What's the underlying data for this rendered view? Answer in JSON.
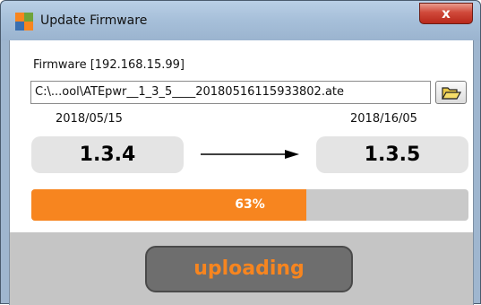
{
  "window": {
    "title": "Update Firmware",
    "close_label": "x"
  },
  "firmware": {
    "label": "Firmware [192.168.15.99]",
    "path_value": "C:\\...ool\\ATEpwr__1_3_5____20180516115933802.ate",
    "browse_icon": "open-folder-icon"
  },
  "current": {
    "date": "2018/05/15",
    "version": "1.3.4"
  },
  "target": {
    "date": "2018/16/05",
    "version": "1.3.5"
  },
  "progress": {
    "percent": 63,
    "label": "63%"
  },
  "action": {
    "label": "uploading"
  },
  "colors": {
    "accent": "#f7851f",
    "track": "#c9c9c9",
    "button": "#6e6e6e",
    "titlebar": "#a6bfd9"
  }
}
